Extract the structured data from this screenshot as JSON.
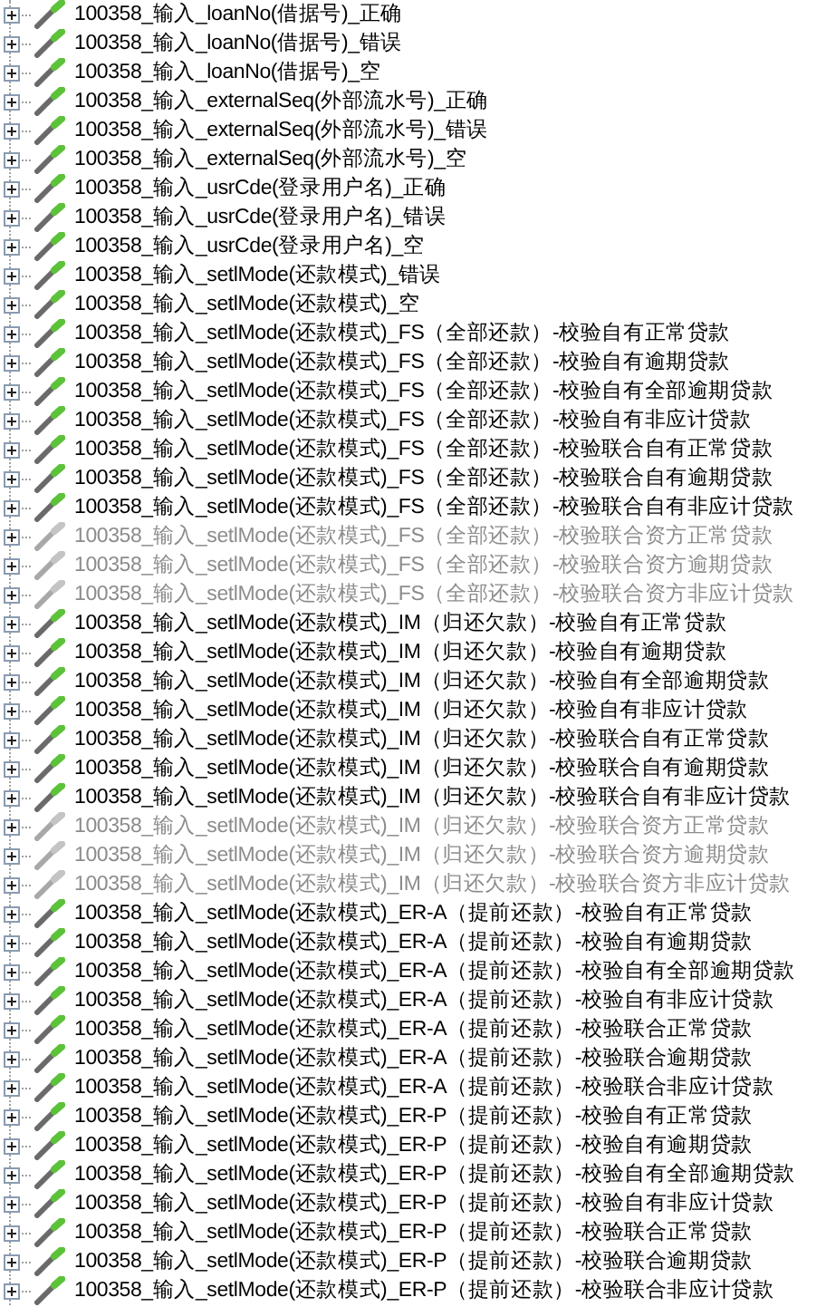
{
  "tree": {
    "items": [
      {
        "label": "100358_输入_loanNo(借据号)_正确",
        "expanded": false,
        "disabled": false
      },
      {
        "label": "100358_输入_loanNo(借据号)_错误",
        "expanded": false,
        "disabled": false
      },
      {
        "label": "100358_输入_loanNo(借据号)_空",
        "expanded": false,
        "disabled": false
      },
      {
        "label": "100358_输入_externalSeq(外部流水号)_正确",
        "expanded": false,
        "disabled": false
      },
      {
        "label": "100358_输入_externalSeq(外部流水号)_错误",
        "expanded": false,
        "disabled": false
      },
      {
        "label": "100358_输入_externalSeq(外部流水号)_空",
        "expanded": false,
        "disabled": false
      },
      {
        "label": "100358_输入_usrCde(登录用户名)_正确",
        "expanded": false,
        "disabled": false
      },
      {
        "label": "100358_输入_usrCde(登录用户名)_错误",
        "expanded": false,
        "disabled": false
      },
      {
        "label": "100358_输入_usrCde(登录用户名)_空",
        "expanded": false,
        "disabled": false
      },
      {
        "label": "100358_输入_setlMode(还款模式)_错误",
        "expanded": false,
        "disabled": false
      },
      {
        "label": "100358_输入_setlMode(还款模式)_空",
        "expanded": false,
        "disabled": false
      },
      {
        "label": "100358_输入_setlMode(还款模式)_FS（全部还款）-校验自有正常贷款",
        "expanded": false,
        "disabled": false
      },
      {
        "label": "100358_输入_setlMode(还款模式)_FS（全部还款）-校验自有逾期贷款",
        "expanded": false,
        "disabled": false
      },
      {
        "label": "100358_输入_setlMode(还款模式)_FS（全部还款）-校验自有全部逾期贷款",
        "expanded": false,
        "disabled": false
      },
      {
        "label": "100358_输入_setlMode(还款模式)_FS（全部还款）-校验自有非应计贷款",
        "expanded": false,
        "disabled": false
      },
      {
        "label": "100358_输入_setlMode(还款模式)_FS（全部还款）-校验联合自有正常贷款",
        "expanded": false,
        "disabled": false
      },
      {
        "label": "100358_输入_setlMode(还款模式)_FS（全部还款）-校验联合自有逾期贷款",
        "expanded": false,
        "disabled": false
      },
      {
        "label": "100358_输入_setlMode(还款模式)_FS（全部还款）-校验联合自有非应计贷款",
        "expanded": false,
        "disabled": false
      },
      {
        "label": "100358_输入_setlMode(还款模式)_FS（全部还款）-校验联合资方正常贷款",
        "expanded": false,
        "disabled": true
      },
      {
        "label": "100358_输入_setlMode(还款模式)_FS（全部还款）-校验联合资方逾期贷款",
        "expanded": false,
        "disabled": true
      },
      {
        "label": "100358_输入_setlMode(还款模式)_FS（全部还款）-校验联合资方非应计贷款",
        "expanded": false,
        "disabled": true
      },
      {
        "label": "100358_输入_setlMode(还款模式)_IM（归还欠款）-校验自有正常贷款",
        "expanded": false,
        "disabled": false
      },
      {
        "label": "100358_输入_setlMode(还款模式)_IM（归还欠款）-校验自有逾期贷款",
        "expanded": false,
        "disabled": false
      },
      {
        "label": "100358_输入_setlMode(还款模式)_IM（归还欠款）-校验自有全部逾期贷款",
        "expanded": false,
        "disabled": false
      },
      {
        "label": "100358_输入_setlMode(还款模式)_IM（归还欠款）-校验自有非应计贷款",
        "expanded": false,
        "disabled": false
      },
      {
        "label": "100358_输入_setlMode(还款模式)_IM（归还欠款）-校验联合自有正常贷款",
        "expanded": false,
        "disabled": false
      },
      {
        "label": "100358_输入_setlMode(还款模式)_IM（归还欠款）-校验联合自有逾期贷款",
        "expanded": false,
        "disabled": false
      },
      {
        "label": "100358_输入_setlMode(还款模式)_IM（归还欠款）-校验联合自有非应计贷款",
        "expanded": false,
        "disabled": false
      },
      {
        "label": "100358_输入_setlMode(还款模式)_IM（归还欠款）-校验联合资方正常贷款",
        "expanded": false,
        "disabled": true
      },
      {
        "label": "100358_输入_setlMode(还款模式)_IM（归还欠款）-校验联合资方逾期贷款",
        "expanded": false,
        "disabled": true
      },
      {
        "label": "100358_输入_setlMode(还款模式)_IM（归还欠款）-校验联合资方非应计贷款",
        "expanded": false,
        "disabled": true
      },
      {
        "label": "100358_输入_setlMode(还款模式)_ER-A（提前还款）-校验自有正常贷款",
        "expanded": false,
        "disabled": false
      },
      {
        "label": "100358_输入_setlMode(还款模式)_ER-A（提前还款）-校验自有逾期贷款",
        "expanded": false,
        "disabled": false
      },
      {
        "label": "100358_输入_setlMode(还款模式)_ER-A（提前还款）-校验自有全部逾期贷款",
        "expanded": false,
        "disabled": false
      },
      {
        "label": "100358_输入_setlMode(还款模式)_ER-A（提前还款）-校验自有非应计贷款",
        "expanded": false,
        "disabled": false
      },
      {
        "label": "100358_输入_setlMode(还款模式)_ER-A（提前还款）-校验联合正常贷款",
        "expanded": false,
        "disabled": false
      },
      {
        "label": "100358_输入_setlMode(还款模式)_ER-A（提前还款）-校验联合逾期贷款",
        "expanded": false,
        "disabled": false
      },
      {
        "label": "100358_输入_setlMode(还款模式)_ER-A（提前还款）-校验联合非应计贷款",
        "expanded": false,
        "disabled": false
      },
      {
        "label": "100358_输入_setlMode(还款模式)_ER-P（提前还款）-校验自有正常贷款",
        "expanded": false,
        "disabled": false
      },
      {
        "label": "100358_输入_setlMode(还款模式)_ER-P（提前还款）-校验自有逾期贷款",
        "expanded": false,
        "disabled": false
      },
      {
        "label": "100358_输入_setlMode(还款模式)_ER-P（提前还款）-校验自有全部逾期贷款",
        "expanded": false,
        "disabled": false
      },
      {
        "label": "100358_输入_setlMode(还款模式)_ER-P（提前还款）-校验自有非应计贷款",
        "expanded": false,
        "disabled": false
      },
      {
        "label": "100358_输入_setlMode(还款模式)_ER-P（提前还款）-校验联合正常贷款",
        "expanded": false,
        "disabled": false
      },
      {
        "label": "100358_输入_setlMode(还款模式)_ER-P（提前还款）-校验联合逾期贷款",
        "expanded": false,
        "disabled": false
      },
      {
        "label": "100358_输入_setlMode(还款模式)_ER-P（提前还款）-校验联合非应计贷款",
        "expanded": false,
        "disabled": false
      }
    ]
  }
}
